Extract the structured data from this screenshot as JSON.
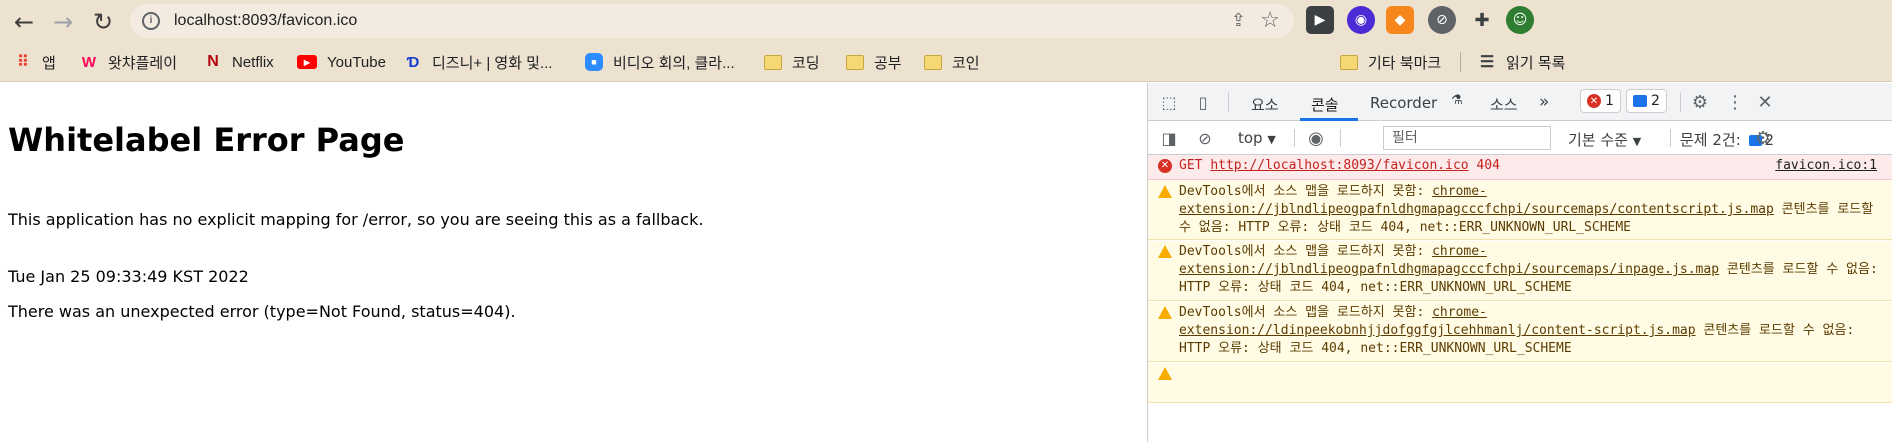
{
  "browser": {
    "url": "localhost:8093/favicon.ico",
    "back_icon": "←",
    "forward_icon": "→",
    "reload_icon": "↻"
  },
  "bookmarks": [
    {
      "label": "앱",
      "icon": "apps-grid-icon",
      "color": "#ea4335"
    },
    {
      "label": "왓챠플레이",
      "icon": "watcha-icon",
      "color": "#ff0558"
    },
    {
      "label": "Netflix",
      "icon": "netflix-icon",
      "color": "#b20710"
    },
    {
      "label": "YouTube",
      "icon": "youtube-icon",
      "color": "#ff0000"
    },
    {
      "label": "디즈니+ | 영화 및...",
      "icon": "disney-icon",
      "color": "#113ccf"
    },
    {
      "label": "비디오 회의, 클라...",
      "icon": "zoom-icon",
      "color": "#2d8cff"
    },
    {
      "label": "코딩",
      "icon": "folder-icon"
    },
    {
      "label": "공부",
      "icon": "folder-icon"
    },
    {
      "label": "코인",
      "icon": "folder-icon"
    },
    {
      "label": "기타 북마크",
      "icon": "folder-icon"
    },
    {
      "label": "읽기 목록",
      "icon": "reading-list-icon"
    }
  ],
  "page": {
    "title": "Whitelabel Error Page",
    "line1": "This application has no explicit mapping for /error, so you are seeing this as a fallback.",
    "line2": "Tue Jan 25 09:33:49 KST 2022",
    "line3": "There was an unexpected error (type=Not Found, status=404)."
  },
  "devtools": {
    "tabs": [
      "요소",
      "콘솔",
      "Recorder",
      "소스"
    ],
    "active_tab": "콘솔",
    "more_tabs": "»",
    "error_count": "1",
    "message_count": "2",
    "context": "top",
    "filter_placeholder": "필터",
    "levels": "기본 수준",
    "issues_label": "문제 2건:",
    "issues_count": "2",
    "messages": [
      {
        "level": "error",
        "method": "GET",
        "url": "http://localhost:8093/favicon.ico",
        "status": "404",
        "source": "favicon.ico:1"
      },
      {
        "level": "warning",
        "prefix": "DevTools에서 소스 맵을 로드하지 못함: ",
        "link": "chrome-extension://jblndlipeogpafnldhgmapagcccfchpi/sourcemaps/contentscript.js.map",
        "suffix": " 콘텐츠를 로드할 수 없음: HTTP 오류: 상태 코드 404, net::ERR_UNKNOWN_URL_SCHEME"
      },
      {
        "level": "warning",
        "prefix": "DevTools에서 소스 맵을 로드하지 못함: ",
        "link": "chrome-extension://jblndlipeogpafnldhgmapagcccfchpi/sourcemaps/inpage.js.map",
        "suffix": " 콘텐츠를 로드할 수 없음: HTTP 오류: 상태 코드 404, net::ERR_UNKNOWN_URL_SCHEME"
      },
      {
        "level": "warning",
        "prefix": "DevTools에서 소스 맵을 로드하지 못함: ",
        "link": "chrome-extension://ldinpeekobnhjjdofggfgjlcehhmanlj/content-script.js.map",
        "suffix": " 콘텐츠를 로드할 수 없음: HTTP 오류: 상태 코드 404, net::ERR_UNKNOWN_URL_SCHEME"
      }
    ]
  },
  "colors": {
    "chrome_bg": "#ede1cf",
    "error_bg": "#fcebea",
    "warning_bg": "#fffbe5",
    "accent": "#1a73e8"
  }
}
